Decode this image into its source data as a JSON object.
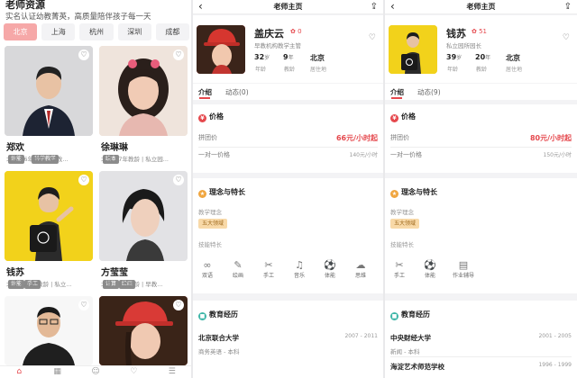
{
  "p1": {
    "title": "老师资源",
    "subtitle": "实名认证幼教菁英，高质量陪伴孩子每一天",
    "cities": [
      "北京",
      "上海",
      "杭州",
      "深圳",
      "成都"
    ],
    "cards": [
      {
        "name": "郑欢",
        "meta": "北京 | 6年教龄 | 早教...",
        "tags": [
          "体能",
          "科学教学"
        ]
      },
      {
        "name": "徐琳琳",
        "meta": "北京 | 7年教龄 | 私立园...",
        "tags": [
          "绘本"
        ]
      },
      {
        "name": "钱苏",
        "meta": "北京 | 20年教龄 | 私立...",
        "tags": [
          "体能",
          "手工"
        ]
      },
      {
        "name": "方莹莹",
        "meta": "北京 | 9年教龄 | 早教...",
        "tags": [
          "计算",
          "绘画"
        ]
      },
      {
        "name": "",
        "meta": "",
        "tags": []
      },
      {
        "name": "",
        "meta": "",
        "tags": []
      }
    ],
    "tabbar": [
      "⌂",
      "▦",
      "☺",
      "♡",
      "☰"
    ]
  },
  "p2": {
    "back": "‹",
    "header": "老师主页",
    "share": "⇪",
    "name": "盖庆云",
    "flowers": "0",
    "title": "早教机构教学主管",
    "age": "32",
    "age_unit": "岁",
    "age_label": "年龄",
    "exp": "9",
    "exp_unit": "年",
    "exp_label": "教龄",
    "city": "北京",
    "city_label": "居住地",
    "follow": "♡",
    "tabs": [
      "介绍",
      "动态(0)"
    ],
    "price_title": "价格",
    "group_label": "拼团价",
    "group_price": "66元/小时起",
    "single_label": "一对一价格",
    "single_price": "140元/小时",
    "idea_title": "理念与特长",
    "idea_label": "教学理念",
    "idea_chip": "五大领域",
    "skill_label": "技能特长",
    "skills": [
      {
        "icon": "∞",
        "label": "双语"
      },
      {
        "icon": "✎",
        "label": "绘画"
      },
      {
        "icon": "✂",
        "label": "手工"
      },
      {
        "icon": "♫",
        "label": "音乐"
      },
      {
        "icon": "⚽",
        "label": "体能"
      },
      {
        "icon": "☁",
        "label": "思维"
      }
    ],
    "edu_title": "教育经历",
    "edu": [
      {
        "school": "北京联合大学",
        "years": "2007 - 2011",
        "major": "商务英语 - 本科"
      }
    ]
  },
  "p3": {
    "back": "‹",
    "header": "老师主页",
    "share": "⇪",
    "name": "钱苏",
    "flowers": "51",
    "title": "私立园所园长",
    "age": "39",
    "age_unit": "岁",
    "age_label": "年龄",
    "exp": "20",
    "exp_unit": "年",
    "exp_label": "教龄",
    "city": "北京",
    "city_label": "居住地",
    "follow": "♡",
    "tabs": [
      "介绍",
      "动态(9)"
    ],
    "price_title": "价格",
    "group_label": "拼团价",
    "group_price": "80元/小时起",
    "single_label": "一对一价格",
    "single_price": "150元/小时",
    "idea_title": "理念与特长",
    "idea_label": "教学理念",
    "idea_chip": "五大领域",
    "skill_label": "技能特长",
    "skills": [
      {
        "icon": "✂",
        "label": "手工"
      },
      {
        "icon": "⚽",
        "label": "体能"
      },
      {
        "icon": "▤",
        "label": "作业辅导"
      }
    ],
    "edu_title": "教育经历",
    "edu": [
      {
        "school": "中央财经大学",
        "years": "2001 - 2005",
        "major": "新闻 - 本科"
      },
      {
        "school": "海淀艺术师范学校",
        "years": "1996 - 1999",
        "major": ""
      }
    ]
  },
  "colors": {
    "accent": "#e5484d",
    "city_active": "#f6a8a8",
    "chip": "#f8d9a8",
    "yellow_bg": "#f2d21b"
  }
}
